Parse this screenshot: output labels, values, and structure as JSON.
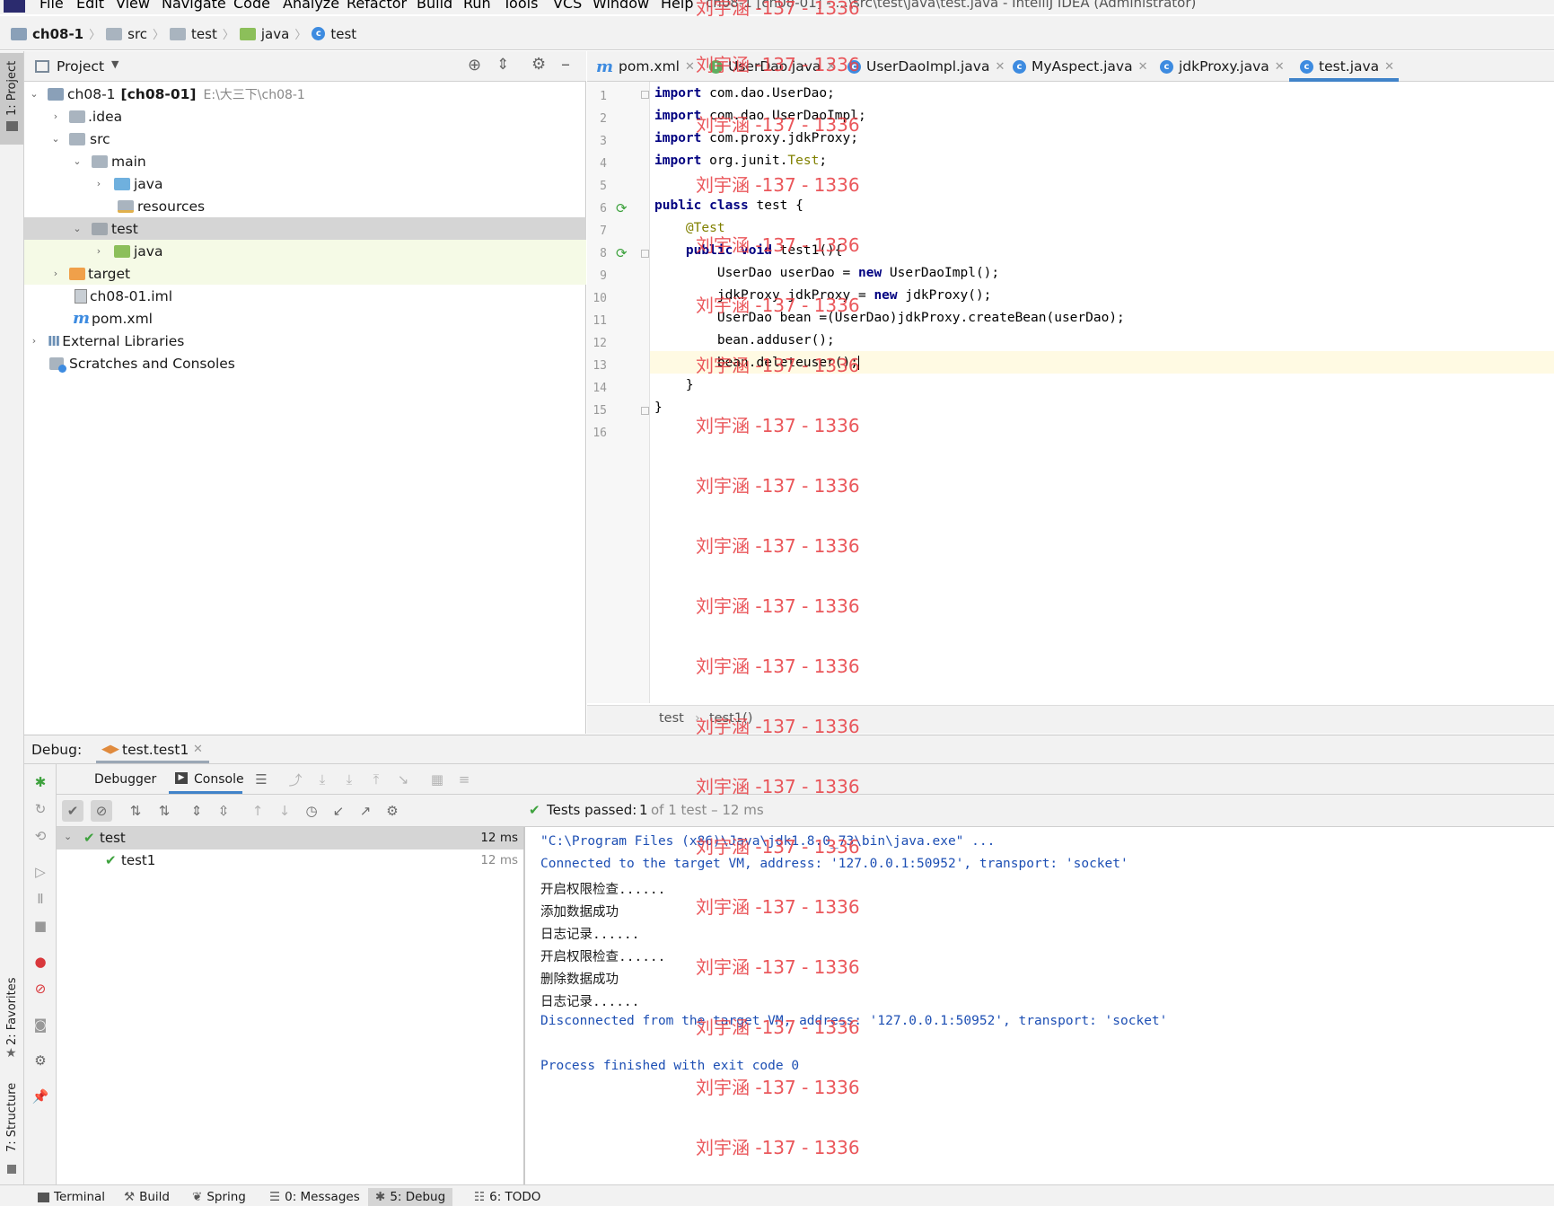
{
  "menu": {
    "items": [
      "File",
      "Edit",
      "View",
      "Navigate",
      "Code",
      "Analyze",
      "Refactor",
      "Build",
      "Run",
      "Tools",
      "VCS",
      "Window",
      "Help"
    ],
    "title": "ch08-1 [ch08-01] - ...\\src\\test\\java\\test.java - IntelliJ IDEA (Administrator)"
  },
  "breadcrumb": {
    "project": "ch08-1",
    "items": [
      "src",
      "test",
      "java",
      "test"
    ]
  },
  "left_strip": {
    "project_label": "1: Project",
    "favorites_label": "2: Favorites",
    "structure_label": "7: Structure"
  },
  "project_panel": {
    "header": "Project",
    "tree": [
      {
        "label": "ch08-1",
        "module": "[ch08-01]",
        "path": "E:\\大三下\\ch08-1"
      },
      {
        "label": ".idea"
      },
      {
        "label": "src"
      },
      {
        "label": "main"
      },
      {
        "label": "java"
      },
      {
        "label": "resources"
      },
      {
        "label": "test"
      },
      {
        "label": "java"
      },
      {
        "label": "target"
      },
      {
        "label": "ch08-01.iml"
      },
      {
        "label": "pom.xml"
      },
      {
        "label": "External Libraries"
      },
      {
        "label": "Scratches and Consoles"
      }
    ]
  },
  "editor": {
    "tabs": [
      "pom.xml",
      "UserDao.java",
      "UserDaoImpl.java",
      "MyAspect.java",
      "jdkProxy.java",
      "test.java"
    ],
    "line_numbers": [
      "1",
      "2",
      "3",
      "4",
      "5",
      "6",
      "7",
      "8",
      "9",
      "10",
      "11",
      "12",
      "13",
      "14",
      "15",
      "16"
    ],
    "code": {
      "l1": {
        "kw": "import",
        "rest": " com.dao.UserDao;"
      },
      "l2": {
        "kw": "import",
        "rest": " com.dao.UserDaoImpl;"
      },
      "l3": {
        "kw": "import",
        "rest": " com.proxy.jdkProxy;"
      },
      "l4": {
        "kw": "import",
        "rest": " org.junit.",
        "junit": "Test",
        "end": ";"
      },
      "l6": {
        "kw": "public class",
        "rest": " test {"
      },
      "l7": {
        "ann": "@Test"
      },
      "l8": {
        "kw": "public void",
        "rest": " test1(){"
      },
      "l9": {
        "a": "UserDao userDao = ",
        "kw": "new",
        "b": " UserDaoImpl();"
      },
      "l10": {
        "a": "jdkProxy jdkProxy = ",
        "kw": "new",
        "b": " jdkProxy();"
      },
      "l11": "UserDao bean =(UserDao)jdkProxy.createBean(userDao);",
      "l12": "bean.adduser();",
      "l13": "bean.deleteuser();",
      "l14": "}",
      "l15": "}"
    },
    "footer": {
      "class_name": "test",
      "method_name": "test1()"
    }
  },
  "debug": {
    "label": "Debug:",
    "run_config": "test.test1",
    "tabs": {
      "debugger": "Debugger",
      "console": "Console"
    },
    "status": {
      "prefix": "Tests passed:",
      "count": "1",
      "suffix": "of 1 test – 12 ms"
    },
    "tests": [
      {
        "name": "test",
        "time": "12 ms"
      },
      {
        "name": "test1",
        "time": "12 ms"
      }
    ],
    "console_lines": [
      "\"C:\\Program Files (x86)\\Java\\jdk1.8.0_73\\bin\\java.exe\" ...",
      "Connected to the target VM, address: '127.0.0.1:50952', transport: 'socket'",
      "开启权限检查......",
      "添加数据成功",
      "日志记录......",
      "开启权限检查......",
      "删除数据成功",
      "日志记录......",
      "Disconnected from the target VM, address: '127.0.0.1:50952', transport: 'socket'",
      "",
      "Process finished with exit code 0"
    ]
  },
  "bottom_bar": [
    "Terminal",
    "Build",
    "Spring",
    "0: Messages",
    "5: Debug",
    "6: TODO"
  ],
  "watermark": "刘宇涵 -137 - 1336",
  "colors": {
    "keyword": "#000080",
    "annotation": "#808000",
    "console_blue": "#1d4fb4",
    "pass_green": "#3ea23e",
    "watermark": "#e8454a"
  }
}
